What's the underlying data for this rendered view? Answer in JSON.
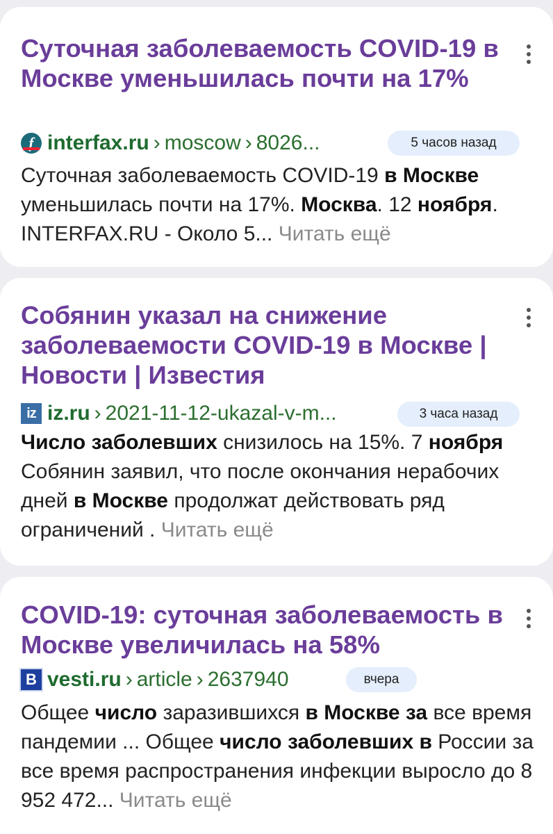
{
  "results": [
    {
      "title": "Суточная заболеваемость COVID-19 в Москве уменьшилась почти на 17%",
      "domain": "interfax.ru",
      "path": [
        "moscow",
        "8026..."
      ],
      "time": "5 часов назад",
      "favicon_icon": "interfax-news-icon",
      "snippet": [
        {
          "t": "Суточная заболеваемость COVID-19 ",
          "b": false
        },
        {
          "t": "в Москве",
          "b": true
        },
        {
          "t": " уменьшилась почти на 17%. ",
          "b": false
        },
        {
          "t": "Москва",
          "b": true
        },
        {
          "t": ". 12 ",
          "b": false
        },
        {
          "t": "ноября",
          "b": true
        },
        {
          "t": ". INTERFAX.RU - Около 5... ",
          "b": false
        }
      ],
      "more": "Читать ещё"
    },
    {
      "title": "Собянин указал на снижение заболеваемости COVID-19 в Москве | Новости | Известия",
      "domain": "iz.ru",
      "path": [
        "2021-11-12-ukazal-v-m..."
      ],
      "time": "3 часа назад",
      "favicon_icon": "iz-logo-icon",
      "snippet": [
        {
          "t": "Число заболевших",
          "b": true
        },
        {
          "t": " снизилось на 15%. 7 ",
          "b": false
        },
        {
          "t": "ноября",
          "b": true
        },
        {
          "t": " Собянин заявил, что после окончания нерабочих дней ",
          "b": false
        },
        {
          "t": "в Москве",
          "b": true
        },
        {
          "t": " продолжат действовать ряд ограничений . ",
          "b": false
        }
      ],
      "more": "Читать ещё"
    },
    {
      "title": "COVID-19: суточная заболеваемость в Москве увеличилась на 58%",
      "domain": "vesti.ru",
      "path": [
        "article",
        "2637940"
      ],
      "time": "вчера",
      "favicon_icon": "vesti-logo-icon",
      "snippet": [
        {
          "t": "Общее ",
          "b": false
        },
        {
          "t": "число",
          "b": true
        },
        {
          "t": " заразившихся ",
          "b": false
        },
        {
          "t": "в Москве за",
          "b": true
        },
        {
          "t": " все время пандемии ... Общее ",
          "b": false
        },
        {
          "t": "число заболевших в",
          "b": true
        },
        {
          "t": " России за все время распространения инфекции выросло до 8 952 472... ",
          "b": false
        }
      ],
      "more": "Читать ещё"
    }
  ],
  "favicon_glyphs": {
    "interfax": "f",
    "iz": "iz",
    "vesti": "B"
  },
  "separator": "›",
  "colors": {
    "title": "#6a3d9a",
    "domain": "#1e6b2f",
    "badge_bg": "#e4eefc",
    "more": "#8a8a8a",
    "page_bg": "#eeeef2"
  }
}
